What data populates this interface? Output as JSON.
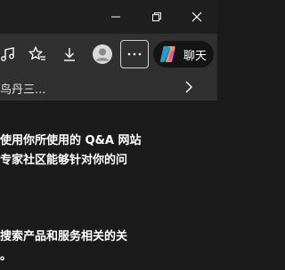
{
  "toolbar": {
    "chat_label": "聊天"
  },
  "favorites": {
    "visible_text": "鸟丹三..."
  },
  "content": {
    "lines": [
      "使用你所使用的 Q&A 网站",
      "专家社区能够针对你的问",
      "搜索产品和服务相关的关",
      "。"
    ]
  },
  "icons": {
    "titlebar": [
      "minimize-icon",
      "restore-icon",
      "close-icon"
    ],
    "toolbar": [
      "music-note-icon",
      "favorites-star-icon",
      "download-icon",
      "profile-avatar-icon",
      "more-options-icon",
      "copilot-icon"
    ],
    "favorites": [
      "chevron-right-icon"
    ]
  }
}
